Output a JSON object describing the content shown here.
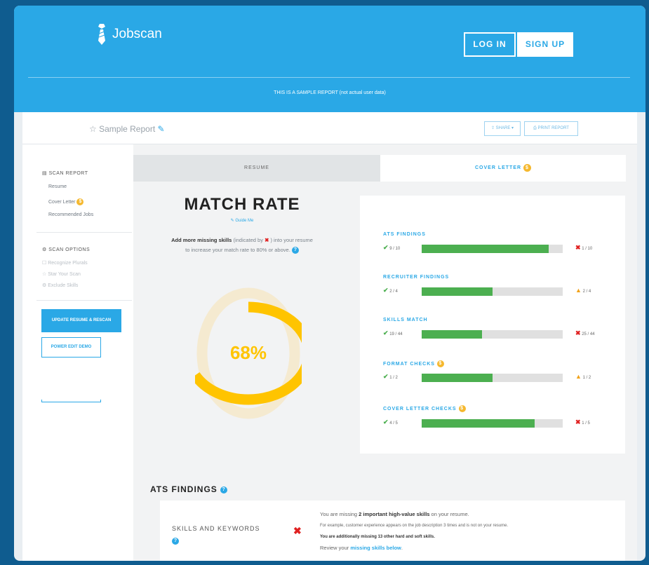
{
  "header": {
    "logo_text": "Jobscan",
    "login_label": "LOG IN",
    "signup_label": "SIGN UP",
    "sample_note": "THIS IS A SAMPLE REPORT (not actual user data)"
  },
  "report": {
    "title": "Sample Report",
    "share_label": "SHARE",
    "print_label": "PRINT REPORT"
  },
  "sidebar": {
    "scan_report_heading": "SCAN REPORT",
    "items": [
      "Resume",
      "Cover Letter",
      "Recommended Jobs"
    ],
    "scan_options_heading": "SCAN OPTIONS",
    "options": [
      "Recognize Plurals",
      "Star Your Scan",
      "Exclude Skills"
    ],
    "update_button": "UPDATE RESUME & RESCAN",
    "power_edit_button": "POWER EDIT DEMO"
  },
  "tabs": {
    "resume": "RESUME",
    "cover_letter": "COVER LETTER"
  },
  "match_rate": {
    "title": "MATCH RATE",
    "guide_link": "Guide Me",
    "desc_bold": "Add more missing skills",
    "desc_mid": "(indicated by",
    "desc_end": ") into your resume to increase your match rate to 80% or above.",
    "value_label": "68%",
    "value": 68
  },
  "findings": [
    {
      "name": "ATS FINDINGS",
      "left": "9 / 10",
      "right": "1 / 10",
      "fill": 0.9,
      "right_icon": "x"
    },
    {
      "name": "RECRUITER FINDINGS",
      "left": "2 / 4",
      "right": "2 / 4",
      "fill": 0.5,
      "right_icon": "warn"
    },
    {
      "name": "SKILLS MATCH",
      "left": "19 / 44",
      "right": "25 / 44",
      "fill": 0.43,
      "right_icon": "x"
    },
    {
      "name": "FORMAT CHECKS",
      "left": "1 / 2",
      "right": "1 / 2",
      "fill": 0.5,
      "right_icon": "warn",
      "coin": true
    },
    {
      "name": "COVER LETTER CHECKS",
      "left": "4 / 5",
      "right": "1 / 5",
      "fill": 0.8,
      "right_icon": "x",
      "coin": true
    }
  ],
  "ats_section": {
    "heading": "ATS FINDINGS",
    "skills_label": "SKILLS AND KEYWORDS",
    "line1_a": "You are missing ",
    "line1_b": "2 important high-value skills",
    "line1_c": " on your resume.",
    "line2": "For example, customer experience appears on the job description 3 times and is not on your resume.",
    "line3": "You are additionally missing 13 other hard and soft skills.",
    "line4_a": "Review your ",
    "line4_b": "missing skills below",
    "line4_c": "."
  },
  "colors": {
    "brand_blue": "#2aa8e6",
    "match_yellow": "#ffc400",
    "green": "#4caf50",
    "red": "#e02020",
    "warning": "#f2a31b"
  }
}
